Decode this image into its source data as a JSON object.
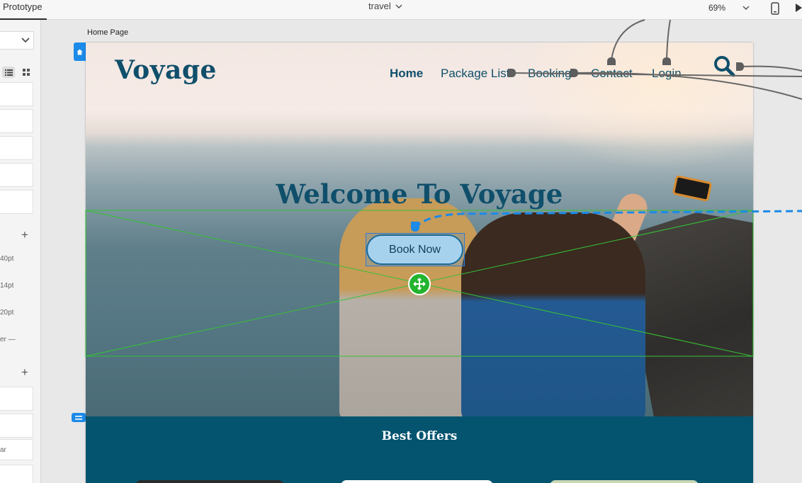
{
  "toolbar": {
    "mode_tab": "Prototype",
    "document_title": "travel",
    "zoom_level": "69%",
    "device_icon": "mobile-device-icon",
    "play_icon": "play-icon"
  },
  "left_panel": {
    "labels": [
      "40pt",
      "14pt",
      "20pt",
      "er —",
      "ar"
    ]
  },
  "canvas": {
    "artboard_title": "Home Page"
  },
  "page": {
    "logo": "Voyage",
    "nav": {
      "home": "Home",
      "package_list": "Package List",
      "booking": "Booking",
      "contact": "Contact",
      "login": "Login"
    },
    "hero_title": "Welcome To Voyage",
    "book_button": "Book Now",
    "offers_title": "Best Offers"
  },
  "colors": {
    "brand": "#0f4f6b",
    "offers_bg": "#04546f",
    "selection": "#1b8ae8",
    "hotspot_green": "#22b42e"
  }
}
